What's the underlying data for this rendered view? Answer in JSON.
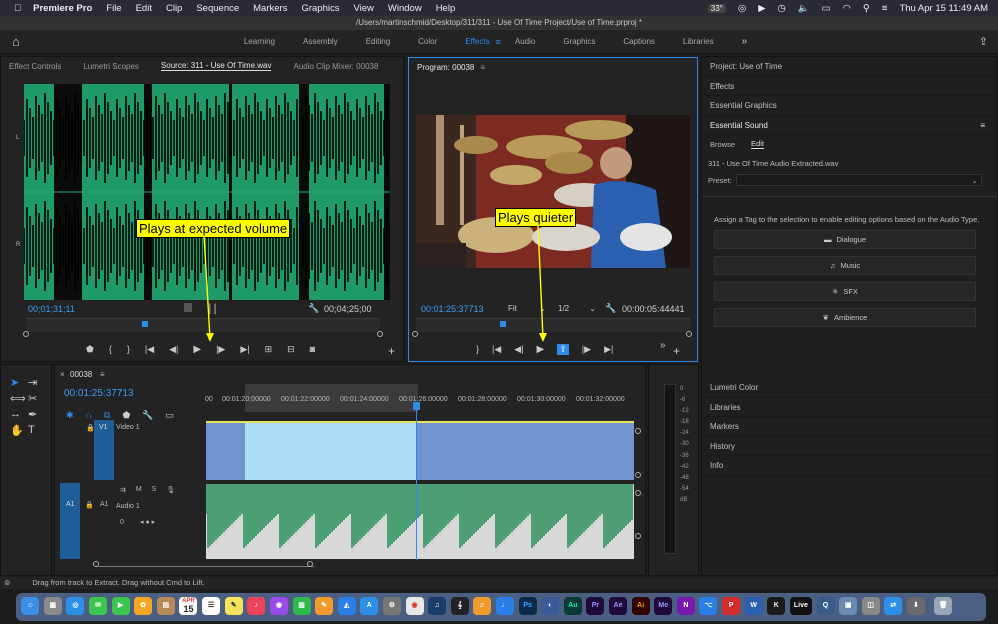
{
  "menubar": {
    "apple": "",
    "app": "Premiere Pro",
    "items": [
      "File",
      "Edit",
      "Clip",
      "Sequence",
      "Markers",
      "Graphics",
      "View",
      "Window",
      "Help"
    ],
    "temp": "33°",
    "datetime": "Thu Apr 15  11:49 AM"
  },
  "titlebar": {
    "path": "/Users/martinschmid/Desktop/311/311 - Use Of Time Project/Use of Time.prproj *"
  },
  "workspaces": [
    "Learning",
    "Assembly",
    "Editing",
    "Color",
    "Effects",
    "Audio",
    "Graphics",
    "Captions",
    "Libraries"
  ],
  "workspace_active": "Effects",
  "source": {
    "tabs": [
      "Effect Controls",
      "Lumetri Scopes",
      "Source: 311 - Use Of Time.wav",
      "Audio Clip Mixer: 00038"
    ],
    "timecode": "00;01;31;11",
    "duration": "00;04;25;00",
    "ch_L": "L",
    "ch_R": "R"
  },
  "program": {
    "title": "Program: 00038",
    "timecode": "00:01:25:37713",
    "fit": "Fit",
    "res": "1/2",
    "duration": "00:00:05:44441"
  },
  "callouts": {
    "left": "Plays at expected volume",
    "right": "Plays quieter"
  },
  "right_panel": {
    "items_top": [
      "Project: Use of Time",
      "Effects",
      "Essential Graphics"
    ],
    "essential_sound": "Essential Sound",
    "tabs": [
      "Browse",
      "Edit"
    ],
    "clip": "311 - Use Of Time Audio Extracted.wav",
    "preset": "Preset:",
    "assign": "Assign a Tag to the selection to enable editing options based on the Audio Type.",
    "tags": [
      "Dialogue",
      "Music",
      "SFX",
      "Ambience"
    ],
    "items_bottom": [
      "Lumetri Color",
      "Libraries",
      "Markers",
      "History",
      "Info"
    ]
  },
  "timeline": {
    "seq": "00038",
    "timecode": "00:01:25:37713",
    "ruler": [
      "00",
      "00:01:20:00000",
      "00:01:22:00000",
      "00:01:24:00000",
      "00:01:26:00000",
      "00:01:28:00000",
      "00:01:30:00000",
      "00:01:32:00000"
    ],
    "v1": "V1",
    "video1": "Video 1",
    "a1": "A1",
    "audio1": "Audio 1",
    "m": "M",
    "s": "S",
    "vol_num": "0"
  },
  "meter": {
    "labels": [
      "0",
      "-6",
      "-12",
      "-18",
      "-24",
      "-30",
      "-36",
      "-42",
      "-48",
      "-54",
      "dB"
    ]
  },
  "status": "Drag from track to Extract. Drag without Cmd to Lift.",
  "dock": {
    "calendar_month": "APR",
    "calendar_day": "15",
    "labels": [
      "Ps",
      "Au",
      "Pr",
      "Ae",
      "Ai",
      "Me",
      "N",
      "Live"
    ]
  }
}
